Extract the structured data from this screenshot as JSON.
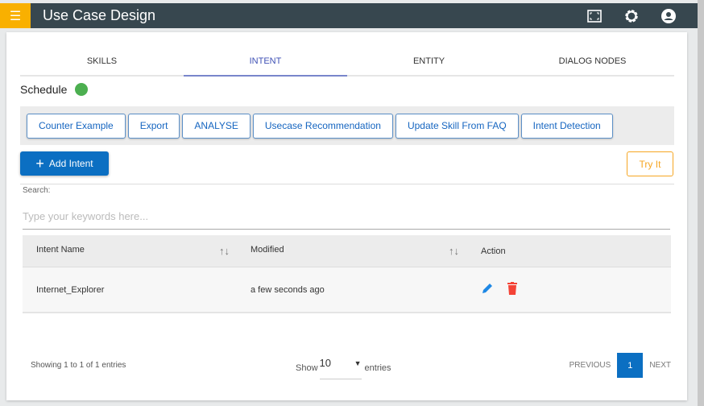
{
  "header": {
    "title": "Use Case Design",
    "menu_icon": "menu-icon",
    "icons": [
      "fullscreen-icon",
      "gear-icon",
      "account-icon"
    ]
  },
  "tabs": [
    {
      "label": "SKILLS"
    },
    {
      "label": "INTENT"
    },
    {
      "label": "ENTITY"
    },
    {
      "label": "DIALOG NODES"
    }
  ],
  "schedule": {
    "label": "Schedule",
    "status_color": "#4caf50"
  },
  "toolbar": {
    "buttons": [
      "Counter Example",
      "Export",
      "ANALYSE",
      "Usecase Recommendation",
      "Update Skill From FAQ",
      "Intent Detection"
    ]
  },
  "add_intent": "Add Intent",
  "try_it": "Try It",
  "search": {
    "label": "Search:",
    "placeholder": "Type your keywords here..."
  },
  "table": {
    "headers": [
      "Intent Name",
      "Modified",
      "Action"
    ],
    "sort_glyph": "↑↓",
    "rows": [
      {
        "name": "Internet_Explorer",
        "modified": "a few seconds ago"
      }
    ]
  },
  "footer": {
    "showing": "Showing 1 to 1 of 1 entries",
    "show": "Show",
    "page_size": "10",
    "entries": "entries",
    "previous": "PREVIOUS",
    "page": "1",
    "next": "NEXT"
  }
}
